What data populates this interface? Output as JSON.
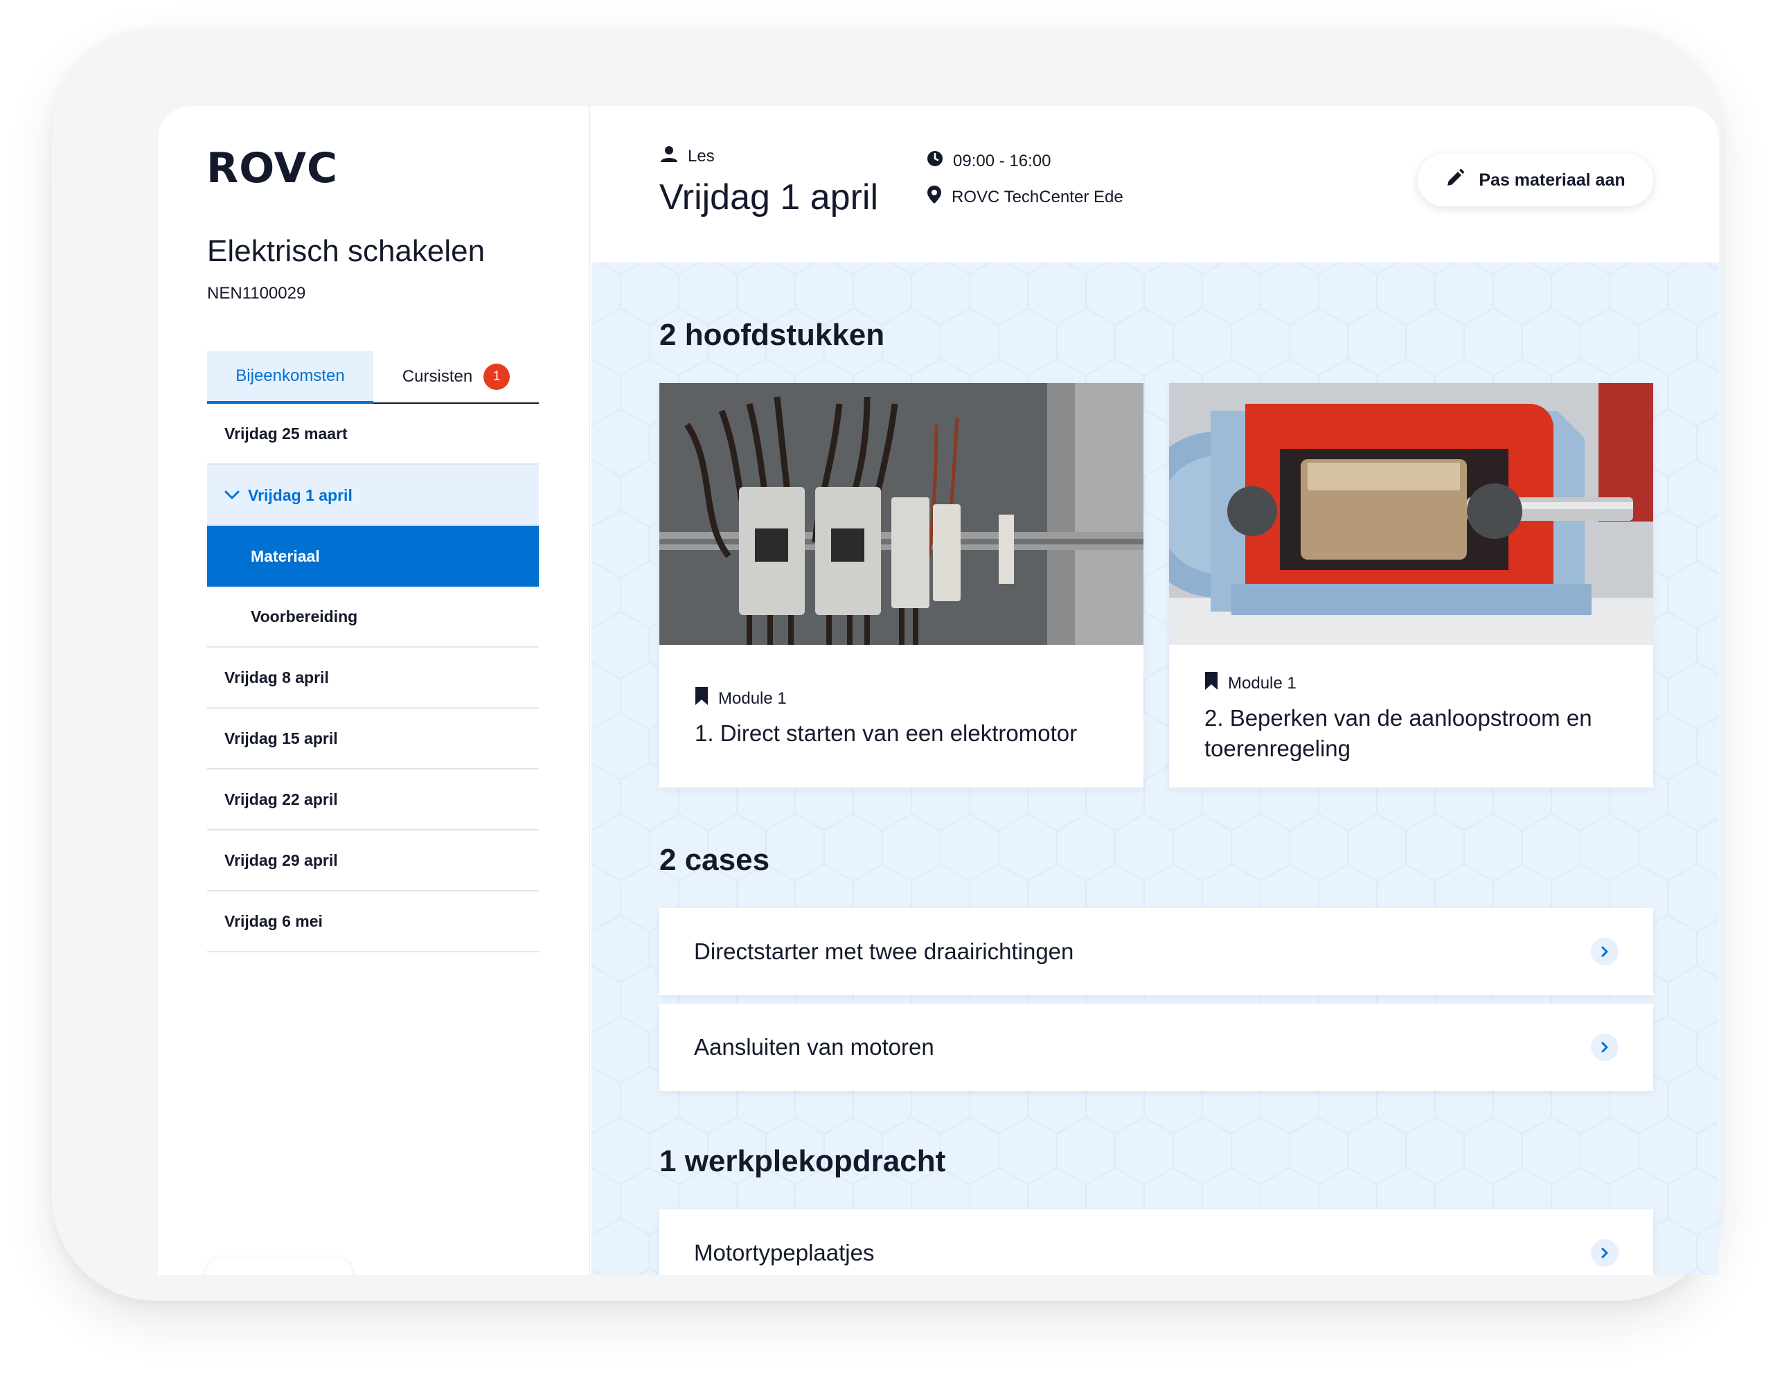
{
  "app": {
    "logo": "ROVC"
  },
  "sidebar": {
    "course_title": "Elektrisch schakelen",
    "course_code": "NEN1100029",
    "tabs": [
      {
        "label": "Bijeenkomsten",
        "active": true
      },
      {
        "label": "Cursisten",
        "badge": "1"
      }
    ],
    "meetings": {
      "m1": "Vrijdag 25 maart",
      "m2": "Vrijdag 1 april",
      "m2_sub_active": "Materiaal",
      "m2_sub_other": "Voorbereiding",
      "m3": "Vrijdag 8 april",
      "m4": "Vrijdag 15 april",
      "m5": "Vrijdag 22 april",
      "m6": "Vrijdag 29 april",
      "m7": "Vrijdag 6 mei"
    }
  },
  "header": {
    "type_label": "Les",
    "date_title": "Vrijdag 1 april",
    "time": "09:00 - 16:00",
    "location": "ROVC TechCenter Ede",
    "edit_button": "Pas materiaal aan"
  },
  "main": {
    "chapters_title": "2 hoofdstukken",
    "chapters": [
      {
        "module": "Module 1",
        "title": "1. Direct starten van een elektromotor",
        "image": "contactor-panel-photo"
      },
      {
        "module": "Module 1",
        "title": "2. Beperken van de aanloopstroom en toerenregeling",
        "image": "electric-motor-cutaway-photo"
      }
    ],
    "cases_title": "2 cases",
    "cases": [
      {
        "label": "Directstarter met twee draairichtingen"
      },
      {
        "label": "Aansluiten van motoren"
      }
    ],
    "assignments_title": "1 werkplekopdracht",
    "assignments": [
      {
        "label": "Motortypeplaatjes"
      }
    ]
  },
  "colors": {
    "primary": "#0070d2",
    "primary_light": "#e6f1fd",
    "text": "#14192b",
    "badge": "#e63b1f",
    "main_background": "#e8f3fd"
  }
}
